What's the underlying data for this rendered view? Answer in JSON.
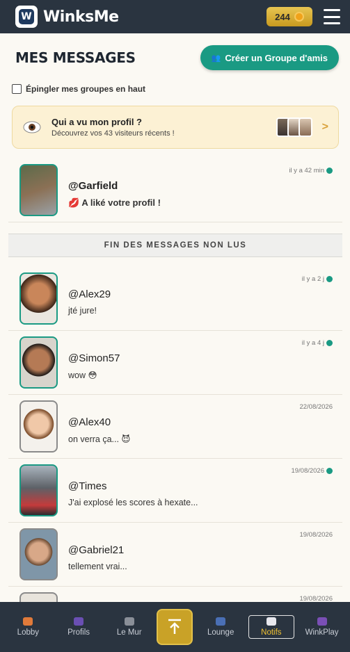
{
  "header": {
    "brand": "WinksMe",
    "coins": "244",
    "logo_letter": "W"
  },
  "title": "MES MESSAGES",
  "create_group_label": "Créer un Groupe d'amis",
  "pin_label": "Épingler mes groupes en haut",
  "visitors": {
    "title": "Qui a vu mon profil ?",
    "subtitle": "Découvrez vos 43 visiteurs récents !",
    "chevron": ">"
  },
  "unread": [
    {
      "username": "@Garfield",
      "preview": "A liké votre profil !",
      "time": "il y a 42 min",
      "online": true
    }
  ],
  "divider_label": "FIN DES MESSAGES NON LUS",
  "messages": [
    {
      "username": "@Alex29",
      "preview": "jté jure!",
      "time": "il y a 2 j",
      "online": true
    },
    {
      "username": "@Simon57",
      "preview": "wow 😳",
      "time": "il y a 4 j",
      "online": true
    },
    {
      "username": "@Alex40",
      "preview": "on verra ça... 😈",
      "time": "22/08/2026",
      "online": false
    },
    {
      "username": "@Times",
      "preview": "J'ai explosé les scores à hexate...",
      "time": "19/08/2026",
      "online": true
    },
    {
      "username": "@Gabriel21",
      "preview": "tellement vrai...",
      "time": "19/08/2026",
      "online": false
    },
    {
      "username": "",
      "preview": "",
      "time": "19/08/2026",
      "online": false
    }
  ],
  "nav": {
    "lobby": "Lobby",
    "profils": "Profils",
    "mur": "Le Mur",
    "lounge": "Lounge",
    "notifs": "Notifs",
    "winkplay": "WinkPlay"
  },
  "colors": {
    "accent": "#1a9a83",
    "header": "#2a3440",
    "gold": "#c9a227"
  }
}
